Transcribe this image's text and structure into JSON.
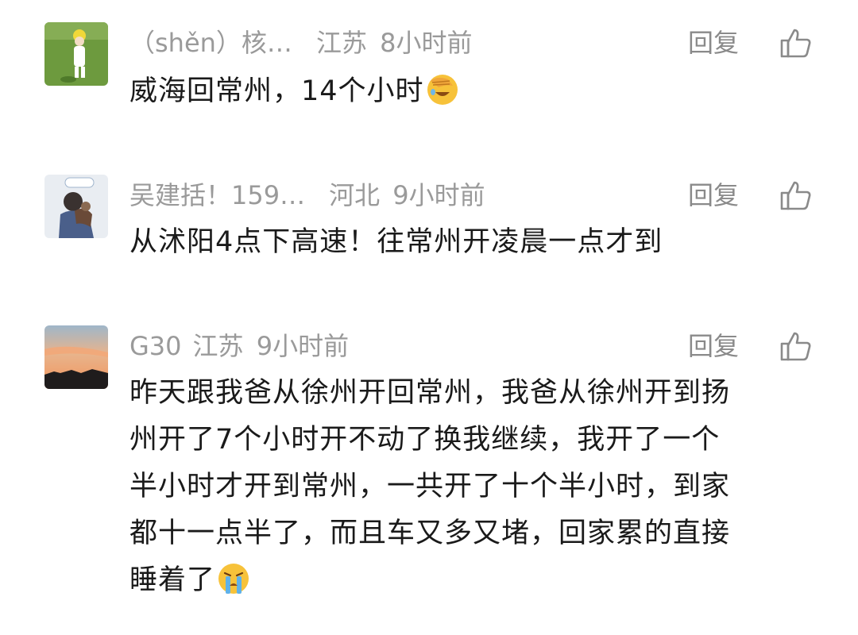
{
  "comments": [
    {
      "username": "（shěn）核…",
      "location": "江苏",
      "time": "8小时前",
      "reply_label": "回复",
      "text": "威海回常州，14个小时",
      "emoji": "face-palm-emoji"
    },
    {
      "username": "吴建括！159…",
      "location": "河北",
      "time": "9小时前",
      "reply_label": "回复",
      "text": "从沭阳4点下高速！往常州开凌晨一点才到",
      "emoji": ""
    },
    {
      "username": "G30",
      "location": "江苏",
      "time": "9小时前",
      "reply_label": "回复",
      "lines": [
        "昨天跟我爸从徐州开回常州，我爸从徐州开到扬",
        "州开了7个小时开不动了换我继续，我开了一个",
        "半小时才开到常州，一共开了十个半小时，到家",
        "都十一点半了，而且车又多又堵，回家累的直接",
        "睡着了"
      ],
      "emoji": "crying-emoji"
    }
  ],
  "icons": {
    "like": "thumbs-up-icon"
  },
  "colors": {
    "meta": "#9a9a9a",
    "text": "#1a1a1a",
    "emoji_yellow": "#f7c23a"
  }
}
